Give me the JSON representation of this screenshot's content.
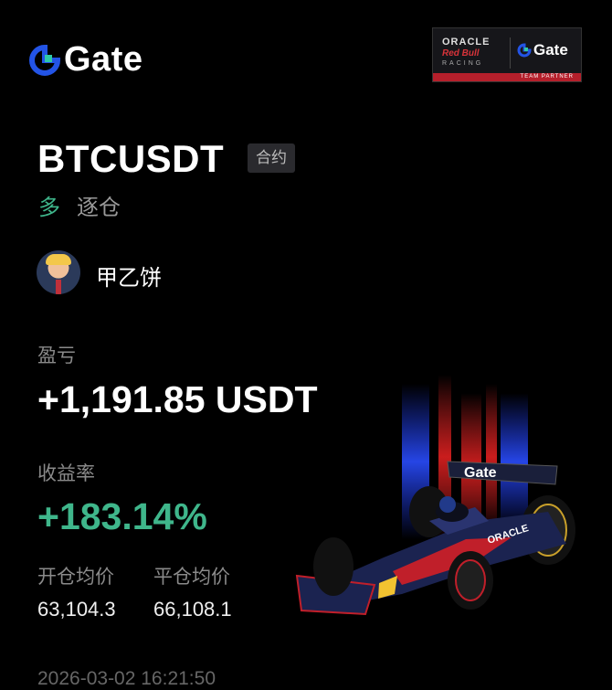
{
  "brand": {
    "logo_text": "Gate"
  },
  "partner_badge": {
    "line1": "ORACLE",
    "line2": "Red Bull",
    "line3": "RACING",
    "brand": "Gate",
    "tagline": "TEAM PARTNER"
  },
  "position": {
    "symbol": "BTCUSDT",
    "type_badge": "合约",
    "side": "多",
    "margin_mode": "逐仓"
  },
  "user": {
    "name": "甲乙饼"
  },
  "pnl": {
    "label": "盈亏",
    "value": "+1,191.85 USDT"
  },
  "roi": {
    "label": "收益率",
    "value": "+183.14%"
  },
  "prices": {
    "open_label": "开仓均价",
    "open_value": "63,104.3",
    "close_label": "平仓均价",
    "close_value": "66,108.1"
  },
  "timestamp": "2026-03-02 16:21:50",
  "colors": {
    "profit_green": "#3fb68b",
    "brand_blue": "#2354e6",
    "red": "#d8333a"
  }
}
